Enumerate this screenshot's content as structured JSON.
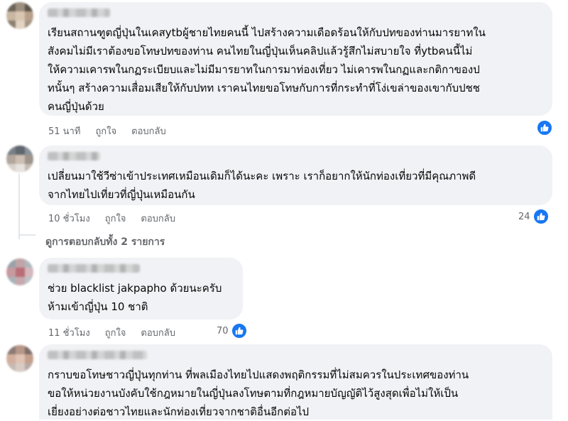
{
  "comments": [
    {
      "text": "เรียนสถานฑูตญี่ปุ่นในเคสytbผู้ชายไทยคนนี้ ไปสร้างความเดือดร้อนให้กับปทของท่านมารยาทใน\nสังคมไม่มีเราต้องขอโทษปทของท่าน คนไทยในญี่ปุ่นเห็นคลิปแล้วรู้สึกไม่สบายใจ ที่ytbคนนี้ไม่\nให้ความเคารพในกฏระเบียบและไม่มีมารยาทในการมาท่องเที่ยว ไม่เคารพในกฏและกติกาของป\nทนั้นๆ สร้างความเสื่อมเสียให้กับปทท เราคนไทยขอโทษกับการที่กระทำที่โง่เขล่าของเขากับปชช\nคนญี่ปุ่นด้วย",
      "time": "51 นาที",
      "like": "ถูกใจ",
      "reply": "ตอบกลับ",
      "reaction_count": ""
    },
    {
      "text": "เปลี่ยนมาใช้วีซ่าเข้าประเทศเหมือนเดิมก็ได้นะคะ เพราะ เราก็อยากให้นักท่องเที่ยวที่มีคุณภาพดี\nจากไทยไปเที่ยวที่ญี่ปุ่นเหมือนกัน",
      "time": "10 ชั่วโมง",
      "like": "ถูกใจ",
      "reply": "ตอบกลับ",
      "reaction_count": "24",
      "view_replies": "ดูการตอบกลับทั้ง 2 รายการ"
    },
    {
      "text": "ช่วย blacklist jakpapho ด้วยนะครับ\nห้ามเข้าญี่ปุ่น 10 ชาติ",
      "time": "11 ชั่วโมง",
      "like": "ถูกใจ",
      "reply": "ตอบกลับ",
      "reaction_count": "70"
    },
    {
      "text": "กราบขอโทษชาวญี่ปุ่นทุกท่าน ที่พลเมืองไทยไปแสดงพฤติกรรมที่ไม่สมควรในประเทศของท่าน\nขอให้หน่วยงานบังคับใช้กฎหมายในญี่ปุ่นลงโทษตามที่กฎหมายบัญญัติไว้สูงสุดเพื่อไม่ให้เป็น\nเยี่ยงอย่างต่อชาวไทยและนักท่องเที่ยวจากชาติอื่นอีกต่อไป"
    }
  ],
  "colors": {
    "bubble": "#f0f2f5",
    "meta_text": "#65676b",
    "like_blue": "#1877f2"
  },
  "icons": {
    "reaction": "thumbs-up-icon"
  }
}
